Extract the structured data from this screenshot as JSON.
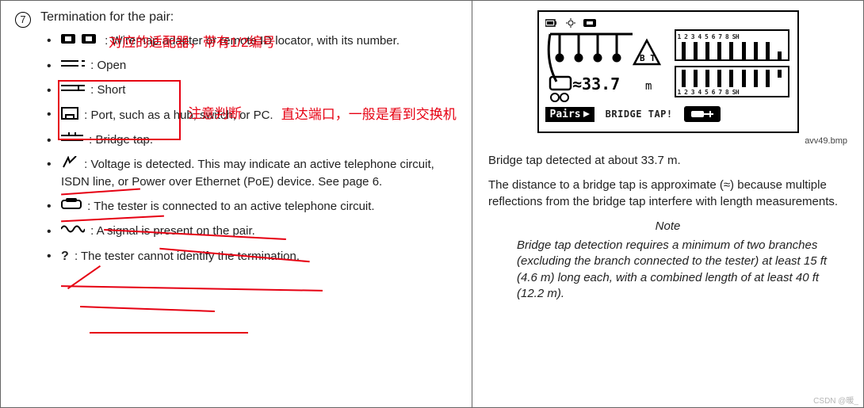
{
  "left": {
    "num": "7",
    "heading": "Termination for the pair:",
    "items": [
      {
        "icon": "adapter-icons",
        "text": ": Wiremap adapter or remote ID locator, with its number."
      },
      {
        "icon": "open-icon",
        "text": ": Open"
      },
      {
        "icon": "short-icon",
        "text": ": Short"
      },
      {
        "icon": "port-icon",
        "text": ": Port, such as a hub, switch, or PC."
      },
      {
        "icon": "bridgetap-icon",
        "text": ": Bridge tap."
      },
      {
        "icon": "voltage-icon",
        "text": ": Voltage is detected. This may indicate an active telephone circuit, ISDN line, or Power over Ethernet (PoE) device. See page 6."
      },
      {
        "icon": "phone-icon",
        "text": ": The tester is connected to an active telephone circuit."
      },
      {
        "icon": "signal-icon",
        "text": ": A signal is present on the pair."
      },
      {
        "icon": "unknown-icon",
        "text": ": The tester cannot identify the termination."
      }
    ],
    "ann": {
      "adapter": "对应的适配器，带有1/2编号",
      "judge": "注意判断",
      "port": "直达端口，一般是看到交换机"
    }
  },
  "right": {
    "filename": "avv49.bmp",
    "lcd": {
      "labels_top": "1 2 3 4 5 6 7 8 SH",
      "labels_bottom": "1 2 3 4 5 6 7 8 SH",
      "len_approx": "≈33.7",
      "len_unit": "m",
      "bt": "B T",
      "pairs": "Pairs",
      "bridge": "BRIDGE TAP!"
    },
    "line1": "Bridge tap detected at about 33.7 m.",
    "line2": "The distance to a bridge tap is approximate (≈) because multiple reflections from the bridge tap interfere with length measurements.",
    "note_title": "Note",
    "note_body": "Bridge tap detection requires a minimum of two branches (excluding the branch connected to the tester) at least 15 ft (4.6 m) long each, with a combined length of at least 40 ft (12.2 m)."
  },
  "watermark": "CSDN @暖_"
}
